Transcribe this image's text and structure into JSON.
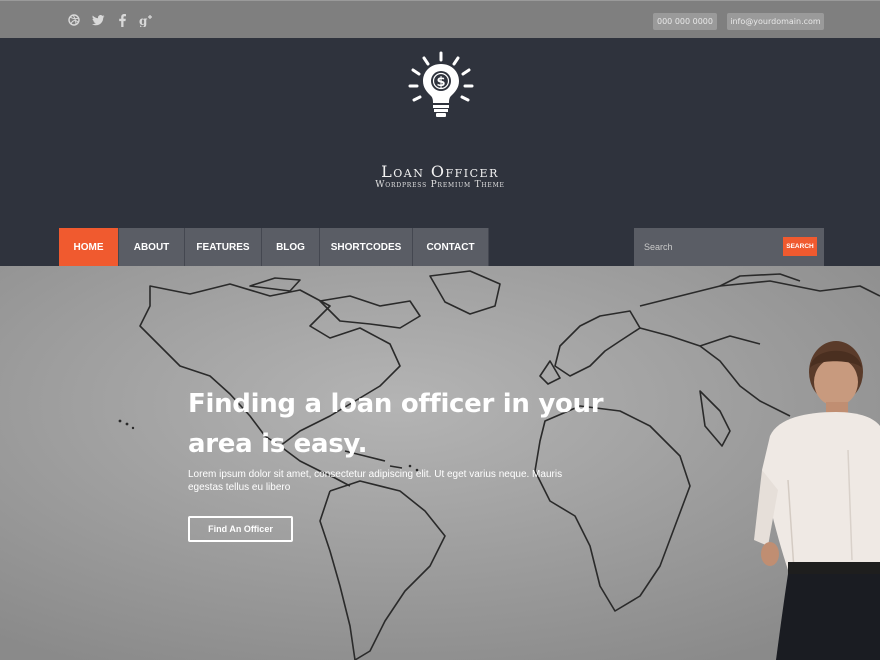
{
  "topbar": {
    "social": [
      {
        "name": "dribbble-icon",
        "glyph": "⊕"
      },
      {
        "name": "twitter-icon",
        "glyph": "🐦︎"
      },
      {
        "name": "facebook-icon",
        "glyph": "f"
      },
      {
        "name": "google-plus-icon",
        "glyph": "g+"
      }
    ],
    "phone": "000 000 0000",
    "email": "info@yourdomain.com"
  },
  "header": {
    "brand": "Loan Officer",
    "tagline": "Wordpress Premium Theme"
  },
  "nav": {
    "items": [
      "HOME",
      "ABOUT",
      "FEATURES",
      "BLOG",
      "SHORTCODES",
      "CONTACT"
    ],
    "active": "HOME"
  },
  "search": {
    "placeholder": "Search",
    "button": "SEARCH"
  },
  "hero": {
    "title": "Finding a loan officer in your area is easy.",
    "text": "Lorem ipsum dolor sit amet, consectetur adipiscing elit. Ut eget varius neque. Mauris egestas tellus eu libero",
    "button": "Find An Officer"
  },
  "colors": {
    "accent": "#f05a2f",
    "header_bg": "#2f333d",
    "nav_bg": "#5a5d65",
    "topbar_bg": "#7f7f7f"
  }
}
